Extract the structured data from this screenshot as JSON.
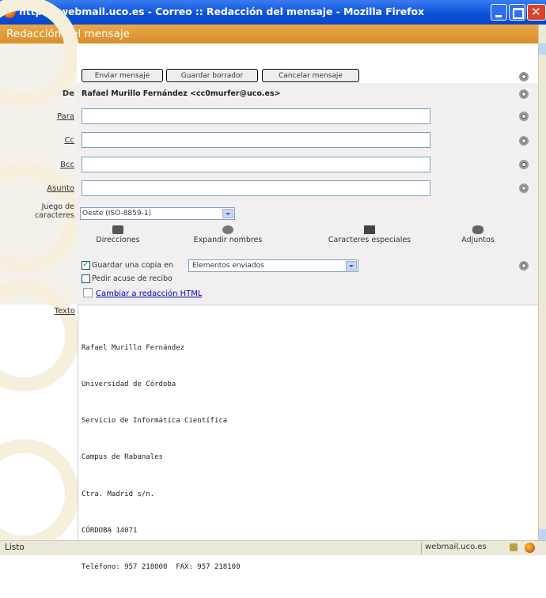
{
  "window": {
    "title": "https://webmail.uco.es - Correo :: Redacción del mensaje - Mozilla Firefox"
  },
  "app": {
    "header": "Redacción del mensaje"
  },
  "toolbar": {
    "send_label": "Enviar mensaje",
    "save_label": "Guardar borrador",
    "cancel_label": "Cancelar mensaje"
  },
  "fields": {
    "from_label": "De",
    "from_value": "Rafael Murillo Fernández <cc0murfer@uco.es>",
    "to_label": "Para",
    "cc_label": "Cc",
    "bcc_label": "Bcc",
    "subject_label": "Asunto",
    "charset_label": "Juego de caracteres",
    "charset_value": "Oeste (ISO-8859-1)"
  },
  "tools": {
    "addresses": "Direcciones",
    "expand_names": "Expandir nombres",
    "special_chars": "Caracteres especiales",
    "attachments": "Adjuntos"
  },
  "options": {
    "save_copy_label": "Guardar una copia en",
    "save_copy_folder": "Elementos enviados",
    "read_receipt_label": "Pedir acuse de recibo",
    "html_link": "Cambiar a redacción HTML"
  },
  "body": {
    "text_label": "Texto",
    "signature": [
      "Rafael Murillo Fernández",
      "Universidad de Córdoba",
      "Servicio de Informática Científica",
      "Campus de Rabanales",
      "Ctra. Madrid s/n.",
      "CÓRDOBA 14071",
      "Teléfono: 957 218000  FAX: 957 218100"
    ]
  },
  "status": {
    "text": "Listo",
    "domain": "webmail.uco.es"
  }
}
